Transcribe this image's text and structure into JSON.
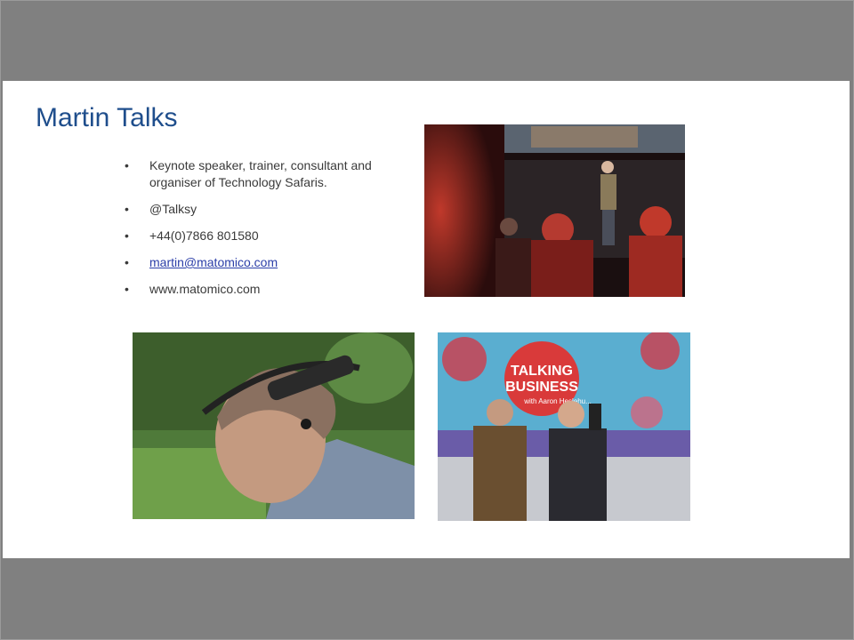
{
  "slide": {
    "title": "Martin Talks",
    "bullets": [
      {
        "text": "Keynote speaker, trainer, consultant and organiser of Technology Safaris.",
        "link": false
      },
      {
        "text": "@Talksy",
        "link": false
      },
      {
        "text": "+44(0)7866 801580",
        "link": false
      },
      {
        "text": "martin@matomico.com",
        "link": true
      },
      {
        "text": "www.matomico.com",
        "link": false
      }
    ],
    "bullet_glyph": "•",
    "photo_tv": {
      "sign_line1": "TALKING",
      "sign_line2": "BUSINESS",
      "sign_line3": "with Aaron Heslehu..."
    }
  },
  "colors": {
    "title": "#1f4e8c",
    "link": "#2b3ea8",
    "band": "#808080"
  }
}
